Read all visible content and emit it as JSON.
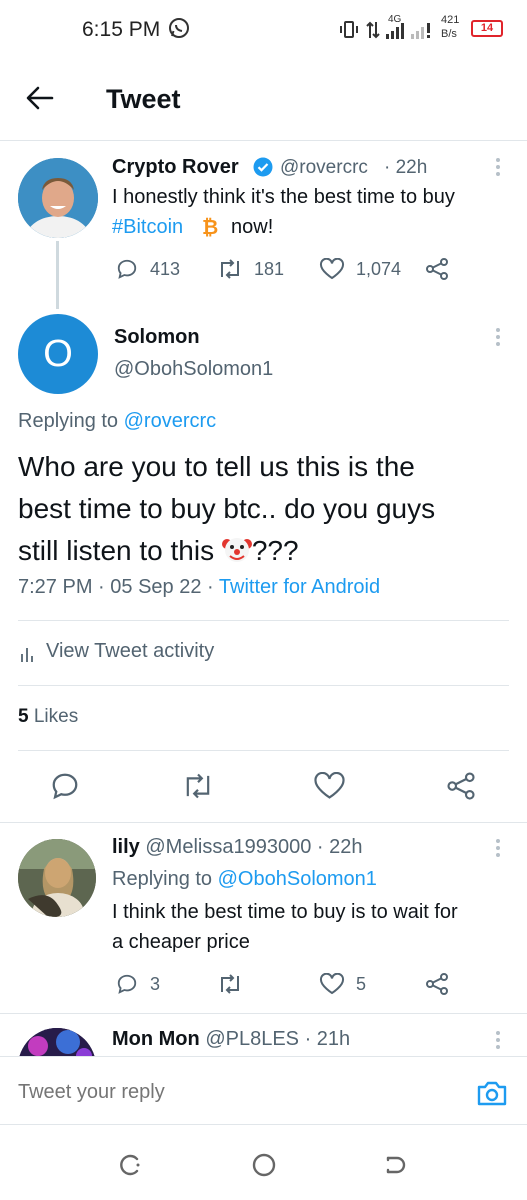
{
  "status_bar": {
    "time": "6:15 PM",
    "network": "4G",
    "speed_value": "421",
    "speed_unit": "B/s",
    "battery": "14"
  },
  "header": {
    "title": "Tweet"
  },
  "parent_tweet": {
    "name": "Crypto Rover",
    "handle": "@rovercrc",
    "time": "· 22h",
    "text_line1": "I honestly think it's the best time to buy",
    "hashtag": "#Bitcoin",
    "text_end": "now!",
    "replies": "413",
    "retweets": "181",
    "likes": "1,074"
  },
  "main_tweet": {
    "avatar_letter": "O",
    "name": "Solomon",
    "handle": "@ObohSolomon1",
    "replying_prefix": "Replying to",
    "replying_handle": "@rovercrc",
    "text_line1": "Who are you to tell us this is the",
    "text_line2": "best time to buy btc.. do you guys",
    "text_line3_start": "still listen to this",
    "text_line3_end": "???",
    "time": "7:27 PM",
    "date": "05 Sep 22",
    "source": "Twitter for Android",
    "activity_label": "View Tweet activity",
    "likes_count": "5",
    "likes_label": "Likes"
  },
  "reply_1": {
    "name": "lily",
    "handle": "@Melissa1993000",
    "time": "· 22h",
    "replying_prefix": "Replying to",
    "replying_handle": "@ObohSolomon1",
    "text_line1": "I think the best time to buy is to wait for",
    "text_line2": "a cheaper price",
    "replies": "3",
    "likes": "5"
  },
  "reply_2": {
    "name": "Mon Mon",
    "handle": "@PL8LES",
    "time": "· 21h"
  },
  "composer": {
    "placeholder": "Tweet your reply"
  },
  "colors": {
    "accent": "#1d9bf0",
    "avatar_blue": "#1d8bd6",
    "battery_red": "#e0242b"
  }
}
